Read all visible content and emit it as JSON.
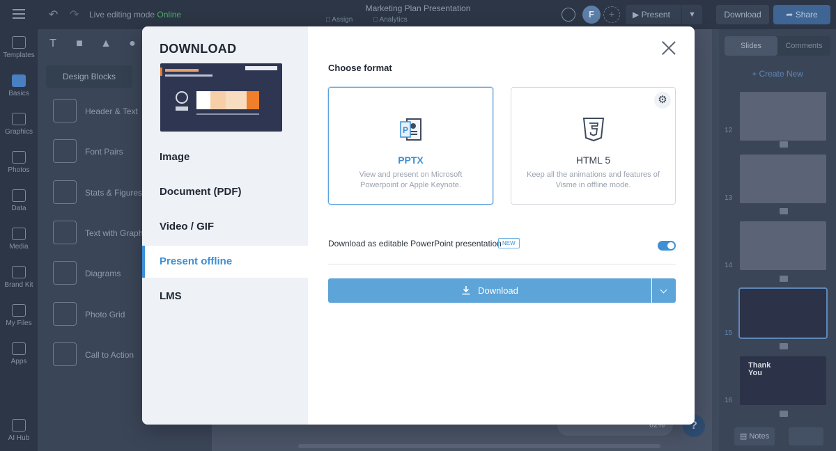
{
  "app": {
    "doc_title": "Marketing Plan Presentation",
    "live_mode_label": "Live editing mode",
    "live_mode_status": "Online",
    "assign_label": "Assign",
    "analytics_label": "Analytics",
    "avatar_initial": "F",
    "present_label": "Present",
    "download_label": "Download",
    "share_label": "Share",
    "zoom_value": "62%",
    "help_label": "?"
  },
  "left_rail": {
    "items": [
      {
        "label": "Templates"
      },
      {
        "label": "Basics"
      },
      {
        "label": "Graphics"
      },
      {
        "label": "Photos"
      },
      {
        "label": "Data"
      },
      {
        "label": "Media"
      },
      {
        "label": "Brand Kit"
      },
      {
        "label": "My Files"
      },
      {
        "label": "Apps"
      },
      {
        "label": "AI Hub"
      }
    ]
  },
  "basics_panel": {
    "tool_text": "T",
    "design_blocks_label": "Design Blocks",
    "items": [
      {
        "label": "Header & Text"
      },
      {
        "label": "Font Pairs"
      },
      {
        "label": "Stats & Figures"
      },
      {
        "label": "Text with Graph"
      },
      {
        "label": "Diagrams"
      },
      {
        "label": "Photo Grid"
      },
      {
        "label": "Call to Action"
      }
    ]
  },
  "right_panel": {
    "tab_slides": "Slides",
    "tab_comments": "Comments",
    "create_new": "+ Create New",
    "slide_numbers": [
      "12",
      "13",
      "14",
      "15",
      "16"
    ],
    "thank_you_text": "Thank You",
    "notes_label": "Notes"
  },
  "modal": {
    "title": "DOWNLOAD",
    "menu": [
      {
        "label": "Image"
      },
      {
        "label": "Document (PDF)"
      },
      {
        "label": "Video / GIF"
      },
      {
        "label": "Present offline"
      },
      {
        "label": "LMS"
      }
    ],
    "active_menu": "Present offline",
    "choose_format_label": "Choose format",
    "formats": [
      {
        "title": "PPTX",
        "description": "View and present on Microsoft Powerpoint or Apple Keynote.",
        "icon": "pptx-file-icon"
      },
      {
        "title": "HTML 5",
        "description": "Keep all the animations and features of Visme in offline mode.",
        "icon": "html5-icon"
      }
    ],
    "selected_format": "PPTX",
    "editable_option_label": "Download as editable PowerPoint presentation",
    "new_badge": "NEW",
    "editable_option_enabled": true,
    "download_button_label": "Download"
  },
  "colors": {
    "accent": "#3d8fd6",
    "download_button": "#5da4d8",
    "online_green": "#4fb06a",
    "modal_sidebar": "#eef1f5"
  }
}
